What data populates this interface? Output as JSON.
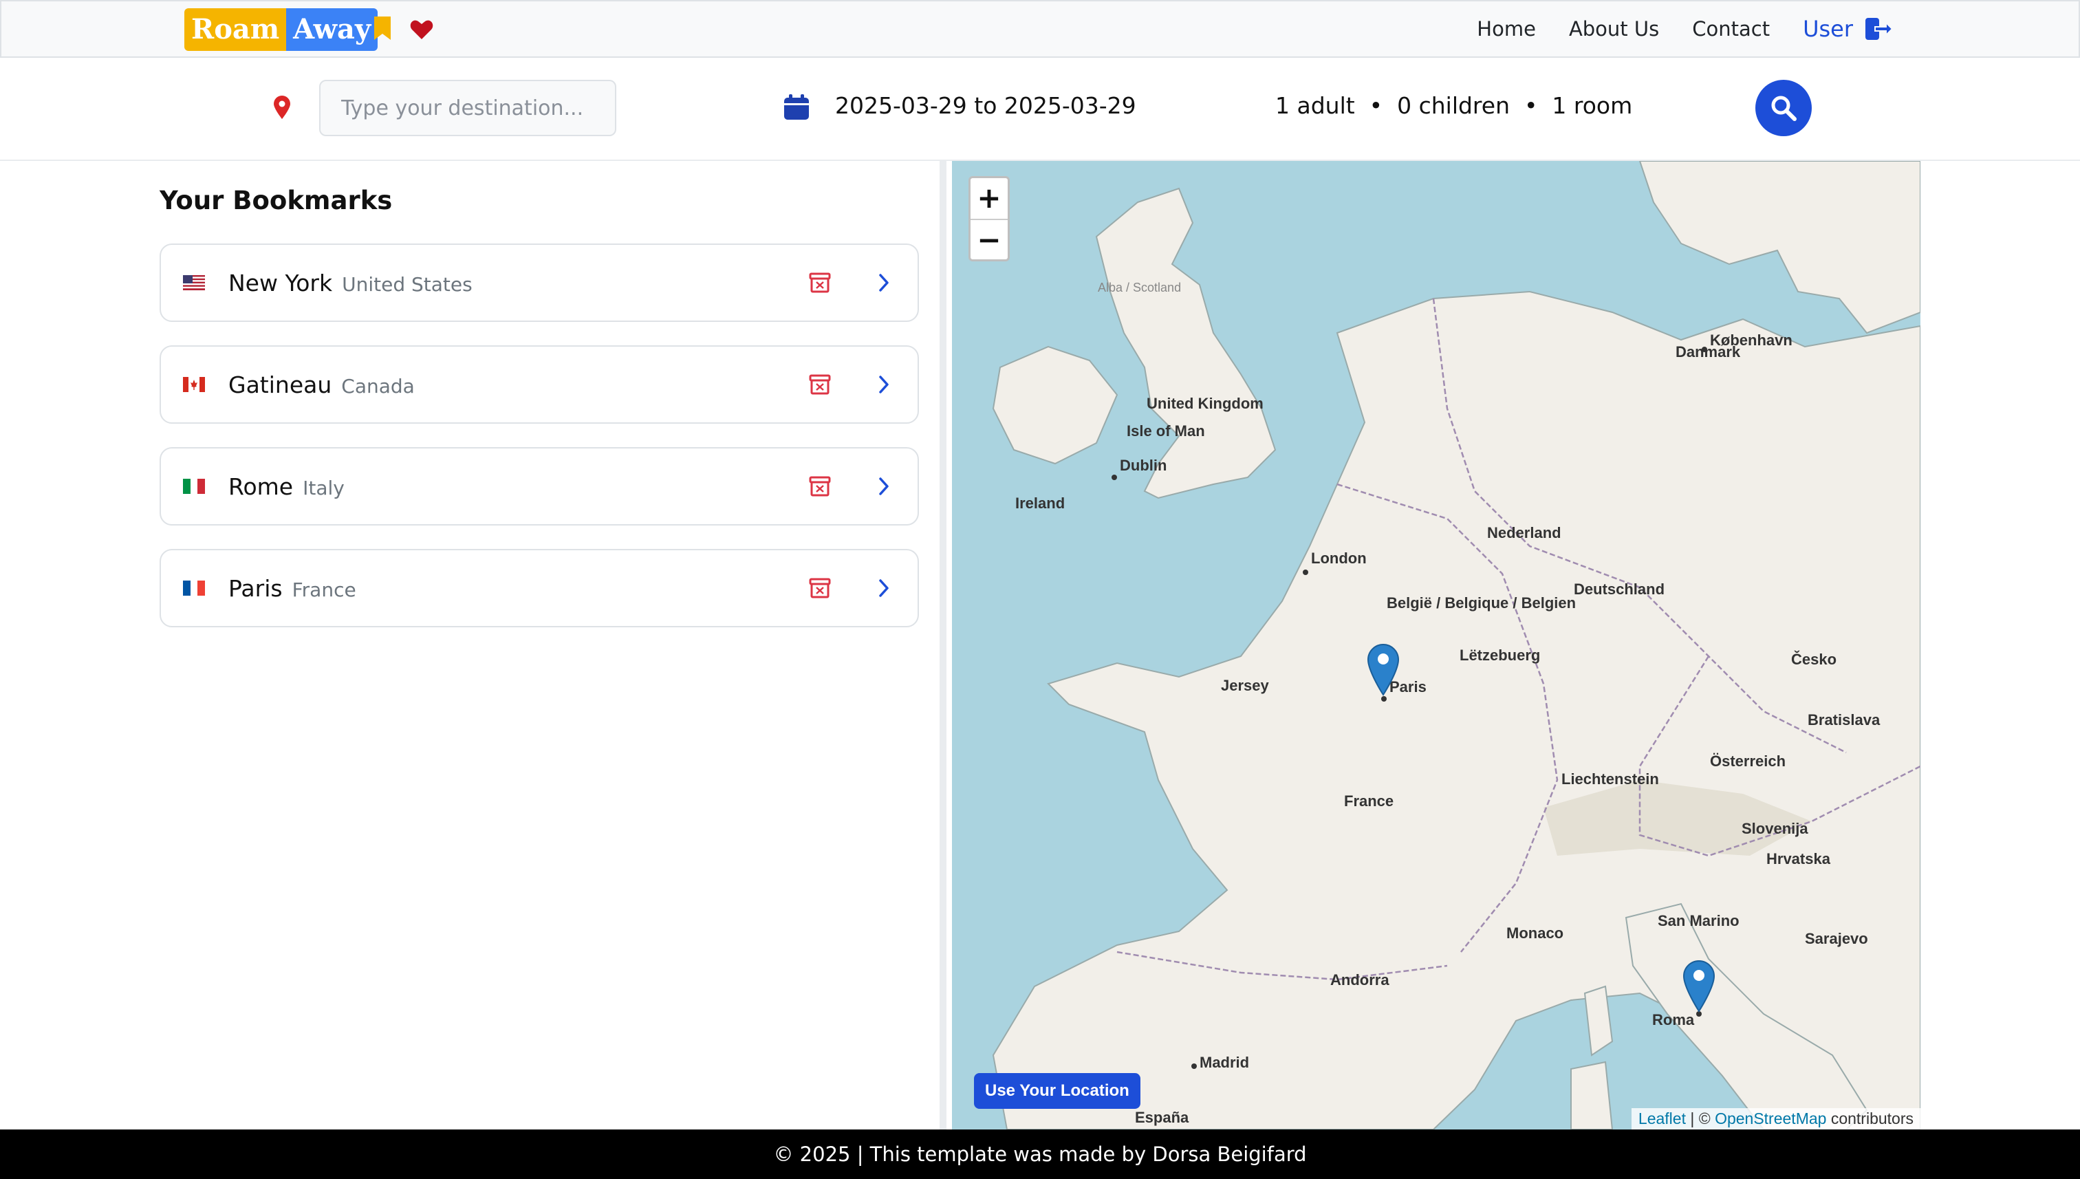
{
  "navbar": {
    "logo_part1": "Roam",
    "logo_part2": "Away",
    "bookmarks_icon": "bookmark-icon",
    "favorites_icon": "heart-icon",
    "links": [
      "Home",
      "About Us",
      "Contact"
    ],
    "user_label": "User",
    "user_icon": "logout-icon"
  },
  "search": {
    "location_icon": "map-pin-icon",
    "destination_placeholder": "Type your destination...",
    "calendar_icon": "calendar-icon",
    "date_range": "2025-03-29 to 2025-03-29",
    "guests": "1 adult  •  0 children  •  1 room",
    "search_icon": "search-icon"
  },
  "bookmarks": {
    "title": "Your Bookmarks",
    "items": [
      {
        "city": "New York",
        "country": "United States",
        "flag": "us"
      },
      {
        "city": "Gatineau",
        "country": "Canada",
        "flag": "ca"
      },
      {
        "city": "Rome",
        "country": "Italy",
        "flag": "it"
      },
      {
        "city": "Paris",
        "country": "France",
        "flag": "fr"
      }
    ]
  },
  "map": {
    "zoom_in": "+",
    "zoom_out": "−",
    "labels": {
      "ireland": "Ireland",
      "uk": "United Kingdom",
      "isle_of_man": "Isle of Man",
      "dublin": "Dublin",
      "london": "London",
      "danmark": "Danmark",
      "kobenhavn": "København",
      "nederland": "Nederland",
      "belgie": "België / Belgique / Belgien",
      "deutschland": "Deutschland",
      "letzebuerg": "Lëtzebuerg",
      "jersey": "Jersey",
      "paris": "Paris",
      "france": "France",
      "cesko": "Česko",
      "osterreich": "Österreich",
      "liechtenstein": "Liechtenstein",
      "bratislava": "Bratislava",
      "slovenija": "Slovenija",
      "hrvatska": "Hrvatska",
      "san_marino": "San Marino",
      "monaco": "Monaco",
      "andorra": "Andorra",
      "madrid": "Madrid",
      "espana": "España",
      "roma": "Roma",
      "sarajevo": "Sarajevo",
      "alba_scotland": "Alba / Scotland"
    },
    "locate_button": "Use Your Location",
    "attribution_leaflet": "Leaflet",
    "attribution_mid": " | © ",
    "attribution_osm": "OpenStreetMap",
    "attribution_end": " contributors"
  },
  "footer": {
    "text": "© 2025 | This template was made by Dorsa Beigifard"
  },
  "colors": {
    "primary": "#1d4ed8",
    "logo_yellow": "#f5b400",
    "logo_blue": "#3b82f6",
    "danger": "#dc3545",
    "map_water": "#aad3df",
    "map_land": "#f2efe9"
  }
}
